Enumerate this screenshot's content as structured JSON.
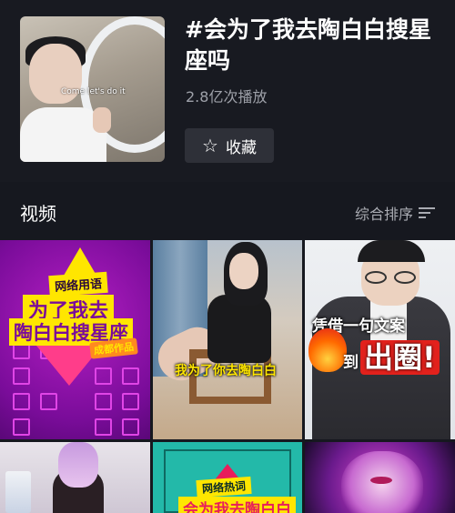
{
  "topic": {
    "title": "#会为了我去陶白白搜星座吗",
    "play_count": "2.8亿次播放",
    "cover_caption": "Come let's do it",
    "favorite_label": "收藏",
    "favorite_icon": "star-outline-icon"
  },
  "section": {
    "title": "视频",
    "sort_label": "综合排序",
    "sort_icon": "sort-lines-icon"
  },
  "videos": [
    {
      "tag": "网络用语",
      "line1": "为了我去",
      "line2": "陶白白搜星座",
      "sticker": "成都作品"
    },
    {
      "subtitle": "我为了你去陶白白"
    },
    {
      "slogan_top": "凭借一句文案",
      "slogan_bottom_prefix": "到",
      "slogan_bottom_emph": "出圈!"
    },
    {},
    {
      "tag": "网络热词",
      "line": "会为我去陶白白"
    },
    {}
  ],
  "colors": {
    "background": "#16181f",
    "button_bg": "#2e3038",
    "muted_text": "#9ea1a9",
    "highlight_yellow": "#ffe600"
  }
}
